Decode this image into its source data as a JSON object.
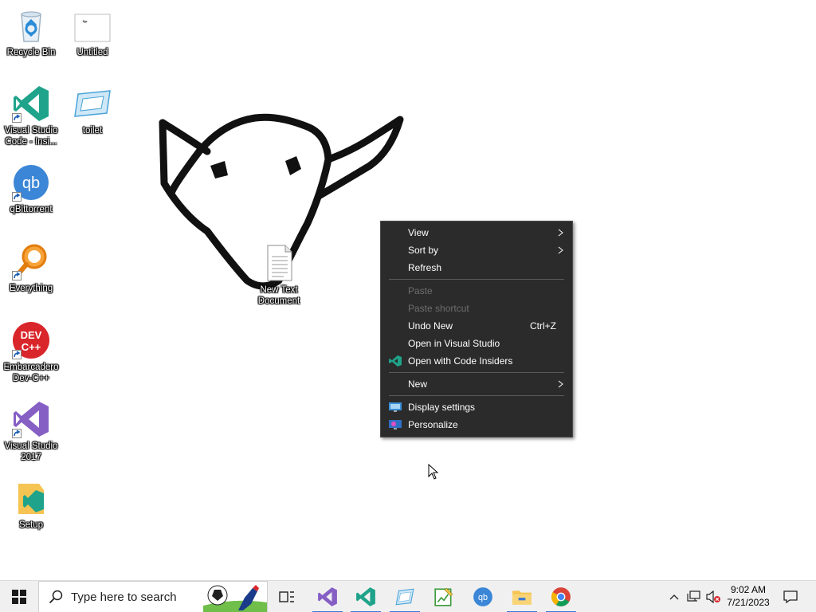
{
  "desktop": {
    "icons": [
      {
        "label": "Recycle Bin"
      },
      {
        "label": "Untitled"
      },
      {
        "label": "Visual Studio Code - Insi..."
      },
      {
        "label": "toilet"
      },
      {
        "label": "qBittorrent"
      },
      {
        "label": "Everything"
      },
      {
        "label": "Embarcadero Dev-C++"
      },
      {
        "label": "Visual Studio 2017"
      },
      {
        "label": "Setup"
      },
      {
        "label": "New Text Document"
      }
    ]
  },
  "context_menu": {
    "items": [
      {
        "label": "View",
        "submenu": true
      },
      {
        "label": "Sort by",
        "submenu": true
      },
      {
        "label": "Refresh"
      },
      {
        "label": "Paste",
        "disabled": true
      },
      {
        "label": "Paste shortcut",
        "disabled": true
      },
      {
        "label": "Undo New",
        "shortcut": "Ctrl+Z"
      },
      {
        "label": "Open in Visual Studio"
      },
      {
        "label": "Open with Code Insiders",
        "icon": "vscode-insiders-icon"
      },
      {
        "label": "New",
        "submenu": true
      },
      {
        "label": "Display settings",
        "icon": "display-settings-icon"
      },
      {
        "label": "Personalize",
        "icon": "personalize-icon"
      }
    ]
  },
  "taskbar": {
    "search_placeholder": "Type here to search",
    "clock_time": "9:02 AM",
    "clock_date": "7/21/2023"
  },
  "colors": {
    "menu_bg": "#2b2b2b",
    "menu_disabled": "#6d6d6d",
    "taskbar_bg": "#f0f0f0",
    "accent": "#3a78d6"
  }
}
